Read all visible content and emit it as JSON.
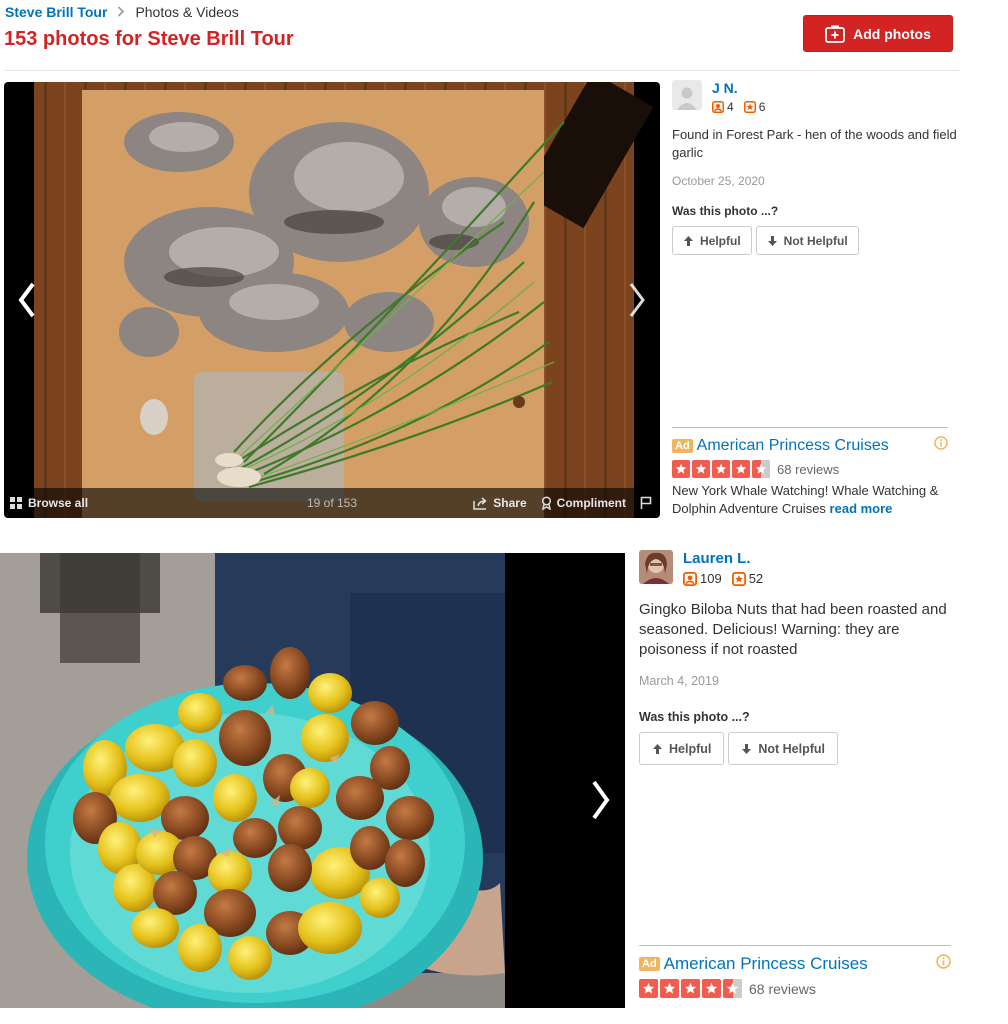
{
  "breadcrumb": {
    "business": "Steve Brill Tour",
    "current": "Photos & Videos"
  },
  "page_title": "153 photos for Steve Brill Tour",
  "add_photos_label": "Add photos",
  "photo1": {
    "browse_all": "Browse all",
    "counter": "19 of 153",
    "share": "Share",
    "compliment": "Compliment",
    "user": {
      "name": "J N.",
      "friends": "4",
      "reviews": "6"
    },
    "caption": "Found in Forest Park - hen of the woods and field garlic",
    "date": "October 25, 2020",
    "was_helpful": "Was this photo ...?",
    "helpful": "Helpful",
    "not_helpful": "Not Helpful"
  },
  "ad1": {
    "badge": "Ad",
    "name": "American Princess Cruises",
    "reviews": "68 reviews",
    "rating": 4.5,
    "description": "New York Whale Watching! Whale Watching & Dolphin Adventure Cruises",
    "read_more": "read more"
  },
  "photo2": {
    "user": {
      "name": "Lauren L.",
      "friends": "109",
      "reviews": "52"
    },
    "caption": "Gingko Biloba Nuts that had been roasted and seasoned. Delicious! Warning: they are poisoness if not roasted",
    "date": "March 4, 2019",
    "was_helpful": "Was this photo ...?",
    "helpful": "Helpful",
    "not_helpful": "Not Helpful"
  },
  "ad2": {
    "badge": "Ad",
    "name": "American Princess Cruises",
    "reviews": "68 reviews",
    "rating": 4.5
  },
  "colors": {
    "brand_red": "#d32323",
    "link_blue": "#0073bb",
    "star_red": "#f15c4f",
    "ad_gold": "#f0b65e"
  }
}
